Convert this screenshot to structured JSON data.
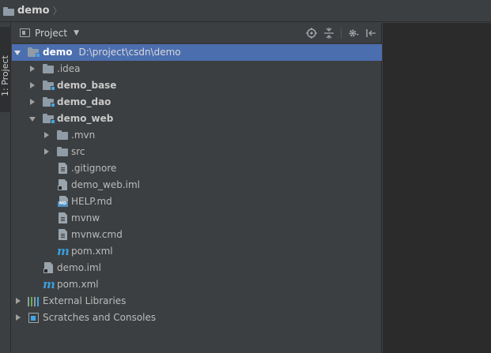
{
  "navbar": {
    "title": "demo",
    "chevron": "〉"
  },
  "toolstrip": {
    "tab_label": "1: Project"
  },
  "panel": {
    "title": "Project",
    "dropdown": "▼",
    "tools": [
      "target-icon",
      "collapse-all-icon",
      "gear-icon",
      "hide-panel-icon"
    ]
  },
  "tree": {
    "root": {
      "name": "demo",
      "path": "D:\\project\\csdn\\demo"
    },
    "idea": ".idea",
    "demo_base": "demo_base",
    "demo_dao": "demo_dao",
    "demo_web": "demo_web",
    "mvn": ".mvn",
    "src": "src",
    "gitignore": ".gitignore",
    "demo_web_iml": "demo_web.iml",
    "help_md": "HELP.md",
    "mvnw": "mvnw",
    "mvnw_cmd": "mvnw.cmd",
    "web_pom": "pom.xml",
    "demo_iml": "demo.iml",
    "root_pom": "pom.xml",
    "external_libraries": "External Libraries",
    "scratches": "Scratches and Consoles"
  },
  "colors": {
    "background": "#3c3f41",
    "selection": "#4b6eaf",
    "editor": "#2b2b2b",
    "module_badge": "#40a7e6",
    "maven_icon": "#3a9ddb"
  },
  "icons": {
    "md_badge": "MD",
    "maven": "m"
  }
}
